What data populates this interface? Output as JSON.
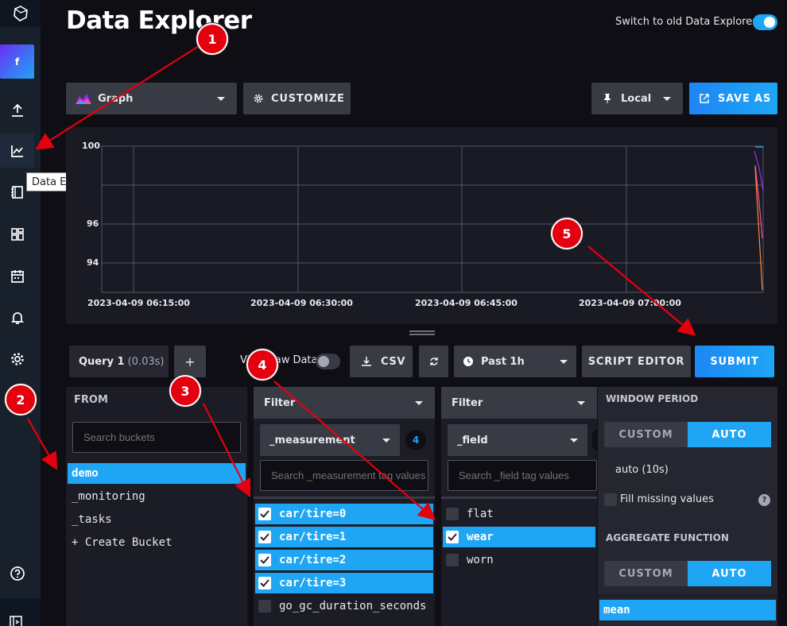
{
  "page": {
    "title": "Data Explorer",
    "switch_label": "Switch to old Data Explorer"
  },
  "nav": {
    "org_initial": "f",
    "tooltip": "Data Explorer"
  },
  "toolbar": {
    "view_type": "Graph",
    "customize": "CUSTOMIZE",
    "timezone": "Local",
    "save_as": "SAVE AS"
  },
  "graph": {
    "y_ticks": [
      "100",
      "96",
      "94"
    ],
    "x_ticks": [
      "2023-04-09 06:15:00",
      "2023-04-09 06:30:00",
      "2023-04-09 06:45:00",
      "2023-04-09 07:00:00"
    ]
  },
  "query_bar": {
    "tab_name": "Query 1",
    "tab_time": "(0.03s)",
    "add": "+",
    "raw_data": "View Raw Data",
    "csv": "CSV",
    "time_range": "Past 1h",
    "script_editor": "SCRIPT EDITOR",
    "submit": "SUBMIT"
  },
  "from": {
    "header": "FROM",
    "search_placeholder": "Search buckets",
    "buckets": [
      "demo",
      "_monitoring",
      "_tasks",
      "+ Create Bucket"
    ],
    "selected": "demo"
  },
  "filter1": {
    "header": "Filter",
    "key": "_measurement",
    "count": "4",
    "search_placeholder": "Search _measurement tag values",
    "values": [
      {
        "label": "car/tire=0",
        "checked": true
      },
      {
        "label": "car/tire=1",
        "checked": true
      },
      {
        "label": "car/tire=2",
        "checked": true
      },
      {
        "label": "car/tire=3",
        "checked": true
      },
      {
        "label": "go_gc_duration_seconds",
        "checked": false
      }
    ]
  },
  "filter2": {
    "header": "Filter",
    "key": "_field",
    "search_placeholder": "Search _field tag values",
    "values": [
      {
        "label": "flat",
        "checked": false
      },
      {
        "label": "wear",
        "checked": true
      },
      {
        "label": "worn",
        "checked": false
      }
    ]
  },
  "window": {
    "header": "WINDOW PERIOD",
    "custom": "CUSTOM",
    "auto": "AUTO",
    "auto_value": "auto (10s)",
    "fill_missing": "Fill missing values",
    "help": "?"
  },
  "aggregate": {
    "header": "AGGREGATE FUNCTION",
    "custom": "CUSTOM",
    "auto": "AUTO",
    "selected_fn": "mean"
  },
  "annotations": [
    "1",
    "2",
    "3",
    "4",
    "5"
  ],
  "colors": {
    "accent": "#1ea6f5",
    "marker": "#e4000f",
    "background": "#0e0e14",
    "panel": "#262631"
  }
}
